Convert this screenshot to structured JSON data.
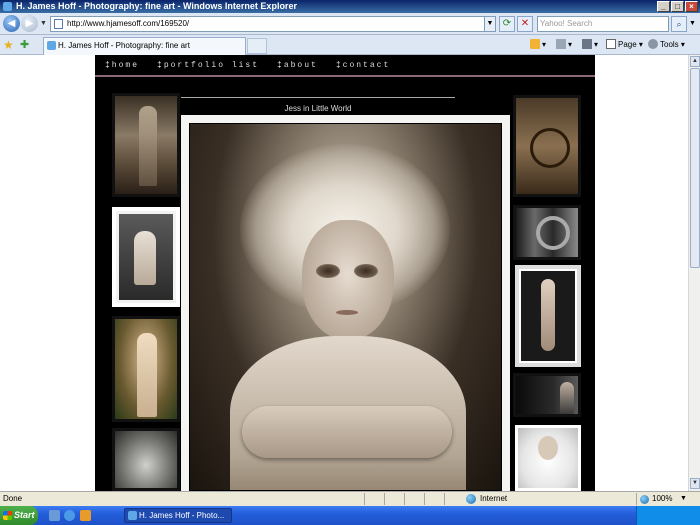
{
  "window": {
    "title": "H. James Hoff - Photography: fine art - Windows Internet Explorer",
    "controls": [
      "_",
      "□",
      "×"
    ]
  },
  "address": {
    "url": "http://www.hjamesoff.com/169520/",
    "search_placeholder": "Yahoo! Search"
  },
  "tabs": [
    {
      "label": "H. James Hoff - Photography: fine art"
    }
  ],
  "command_bar": {
    "page_label": "Page",
    "tools_label": "Tools"
  },
  "site": {
    "nav": [
      "‡home",
      "‡portfolio list",
      "‡about",
      "‡contact"
    ],
    "photo_title": "Jess in Little World"
  },
  "status": {
    "text": "Done",
    "zone": "Internet",
    "zoom": "100%"
  },
  "taskbar": {
    "start_label": "Start",
    "active_window": "H. James Hoff - Photo..."
  },
  "colors": {
    "titlebar": "#0a246a",
    "chrome": "#dde7f3",
    "site_bg": "#000000",
    "nav_rule": "#8a6a78"
  }
}
